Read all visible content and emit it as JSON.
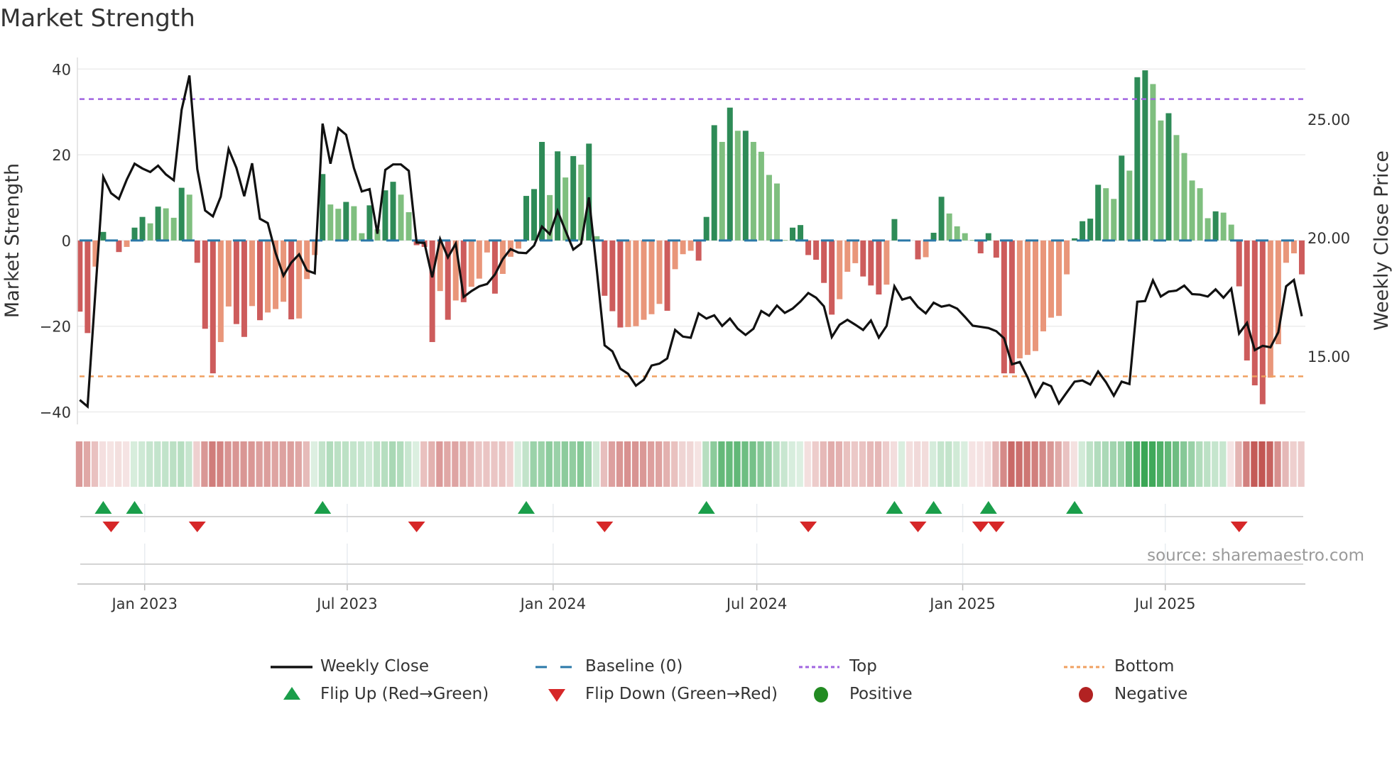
{
  "title": "Market Strength",
  "source": "source: sharemaestro.com",
  "legend": {
    "weekly_close": "Weekly Close",
    "baseline": "Baseline (0)",
    "top": "Top",
    "bottom": "Bottom",
    "flip_up": "Flip Up (Red→Green)",
    "flip_down": "Flip Down (Green→Red)",
    "positive": "Positive",
    "negative": "Negative"
  },
  "colors": {
    "strong_positive": "#2e8b57",
    "weak_positive": "#7fbf7f",
    "strong_negative": "#cd5c5c",
    "weak_negative": "#e9967a",
    "close_line": "#111111",
    "baseline": "#2a78a8",
    "top": "#a064e0",
    "bottom": "#f0a060",
    "flip_up": "#1a9e4a",
    "flip_down": "#d62728",
    "positive_dot": "#228b22",
    "negative_dot": "#b22222"
  },
  "chart_data": {
    "type": "bar",
    "title": "Market Strength",
    "ylabel": "Market Strength",
    "y2label": "Weekly Close Price",
    "x_start": "2022-11-04",
    "x_step_days": 7,
    "ylim": [
      -42.9,
      42.7
    ],
    "y2lim": [
      12.13,
      27.6
    ],
    "yticks": [
      {
        "value": 40,
        "label": "40"
      },
      {
        "value": 20,
        "label": "20"
      },
      {
        "value": 0,
        "label": "0"
      },
      {
        "value": -20,
        "label": "−20"
      },
      {
        "value": -40,
        "label": "−40"
      }
    ],
    "y2ticks": [
      {
        "value": 25,
        "label": "25.00"
      },
      {
        "value": 20,
        "label": "20.00"
      },
      {
        "value": 15,
        "label": "15.00"
      }
    ],
    "xticks": [
      {
        "date": "2023-01-01",
        "label": "Jan 2023"
      },
      {
        "date": "2023-07-01",
        "label": "Jul 2023"
      },
      {
        "date": "2024-01-01",
        "label": "Jan 2024"
      },
      {
        "date": "2024-07-01",
        "label": "Jul 2024"
      },
      {
        "date": "2025-01-01",
        "label": "Jan 2025"
      },
      {
        "date": "2025-07-01",
        "label": "Jul 2025"
      }
    ],
    "top_level": 33,
    "bottom_level": -31.7,
    "baseline": 0,
    "strength": [
      -16.6,
      -21.6,
      -6.1,
      2,
      0,
      -2.7,
      -1.5,
      3,
      5.5,
      4,
      7.9,
      7.5,
      5.3,
      12.3,
      10.7,
      -5.2,
      -20.6,
      -31,
      -23.7,
      -15.4,
      -19.5,
      -22.5,
      -15.3,
      -18.6,
      -16.8,
      -16,
      -14.3,
      -18.4,
      -18.2,
      -9,
      -3.4,
      15.5,
      8.4,
      7.4,
      9,
      8,
      1.7,
      8.2,
      2.6,
      11.7,
      13.7,
      10.7,
      6.6,
      -1.1,
      -1.5,
      -23.7,
      -11.8,
      -18.5,
      -14,
      -14.4,
      -10.8,
      -8.9,
      -2.8,
      -12.4,
      -7.8,
      -3.8,
      -1.9,
      10.4,
      12,
      23,
      10.6,
      20.8,
      14.7,
      19.7,
      17.7,
      22.6,
      1,
      -12.9,
      -16.5,
      -20.3,
      -20.2,
      -20,
      -18.5,
      -17.2,
      -14.8,
      -16.4,
      -6.7,
      -3.2,
      -2.4,
      -4.7,
      5.5,
      26.9,
      23,
      31,
      25.6,
      25.6,
      23,
      20.7,
      15.3,
      13.3,
      0.1,
      3,
      3.6,
      -3.4,
      -4.5,
      -9.9,
      -17.3,
      -13.7,
      -7.3,
      -5.3,
      -8.4,
      -10.5,
      -12.6,
      -10.3,
      5,
      0,
      0,
      -4.4,
      -3.9,
      1.8,
      10.2,
      6.3,
      3.3,
      1.7,
      0.1,
      -3,
      1.7,
      -4,
      -31,
      -31,
      -27.5,
      -26.7,
      -25.8,
      -21.2,
      -18,
      -17.6,
      -7.9,
      0.5,
      4.5,
      5.1,
      13,
      12.2,
      9.7,
      19.8,
      16.3,
      38.1,
      39.7,
      36.5,
      28,
      29.7,
      24.6,
      20.4,
      14,
      12.2,
      5.2,
      6.8,
      6.5,
      3.7,
      -10.7,
      -28,
      -33.8,
      -38.2,
      -32,
      -24.2,
      -5.2,
      -3,
      -7.9
    ],
    "weekly_close": [
      13.16,
      12.88,
      17.75,
      22.56,
      21.88,
      21.63,
      22.45,
      23.12,
      22.92,
      22.77,
      23.04,
      22.67,
      22.42,
      25.39,
      26.84,
      22.89,
      21.15,
      20.9,
      21.73,
      23.74,
      22.94,
      21.75,
      23.14,
      20.8,
      20.62,
      19.35,
      18.4,
      18.95,
      19.3,
      18.62,
      18.5,
      24.81,
      23.12,
      24.62,
      24.34,
      22.94,
      21.95,
      22.05,
      20.17,
      22.86,
      23.09,
      23.09,
      22.82,
      19.8,
      19.78,
      18.33,
      19.95,
      19.17,
      19.75,
      17.5,
      17.75,
      17.95,
      18.05,
      18.45,
      19.1,
      19.52,
      19.37,
      19.35,
      19.67,
      20.47,
      20.15,
      21.13,
      20.3,
      19.5,
      19.75,
      21.7,
      18.65,
      15.46,
      15.21,
      14.48,
      14.26,
      13.76,
      14.01,
      14.61,
      14.69,
      14.91,
      16.11,
      15.83,
      15.78,
      16.81,
      16.59,
      16.73,
      16.28,
      16.59,
      16.16,
      15.9,
      16.16,
      16.91,
      16.71,
      17.14,
      16.83,
      17.01,
      17.31,
      17.67,
      17.47,
      17.11,
      15.81,
      16.33,
      16.54,
      16.33,
      16.11,
      16.51,
      15.79,
      16.28,
      17.95,
      17.39,
      17.49,
      17.08,
      16.81,
      17.26,
      17.09,
      17.16,
      17.01,
      16.66,
      16.29,
      16.24,
      16.19,
      16.06,
      15.76,
      14.66,
      14.76,
      14.11,
      13.31,
      13.88,
      13.74,
      13.01,
      13.48,
      13.93,
      13.98,
      13.81,
      14.36,
      13.91,
      13.34,
      13.93,
      13.83,
      17.3,
      17.33,
      18.2,
      17.52,
      17.73,
      17.77,
      17.98,
      17.62,
      17.6,
      17.52,
      17.82,
      17.47,
      17.85,
      15.96,
      16.41,
      15.26,
      15.44,
      15.38,
      16.01,
      17.95,
      18.22,
      16.69
    ],
    "flip_up_weeks": [
      3,
      7,
      31,
      57,
      80,
      104,
      109,
      116,
      127
    ],
    "flip_down_weeks": [
      4,
      15,
      43,
      67,
      93,
      107,
      115,
      117,
      148
    ]
  }
}
